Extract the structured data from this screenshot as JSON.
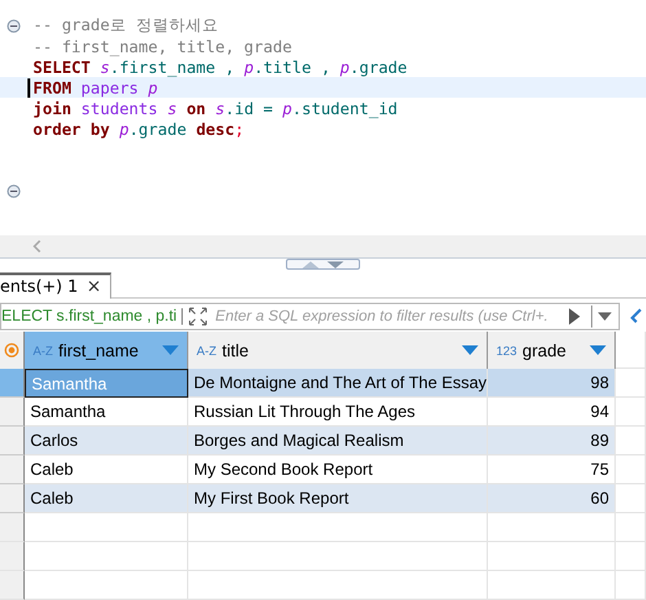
{
  "editor": {
    "lines": [
      {
        "fold": true,
        "current": false,
        "tokens": [
          {
            "kind": "comment",
            "text": "-- grade로 정렬하세요"
          }
        ]
      },
      {
        "fold": false,
        "current": false,
        "tokens": [
          {
            "kind": "comment",
            "text": "-- first_name, title, grade"
          }
        ]
      },
      {
        "fold": false,
        "current": false,
        "tokens": [
          {
            "kind": "keyword",
            "text": "SELECT "
          },
          {
            "kind": "alias",
            "text": "s"
          },
          {
            "kind": "plain",
            "text": ".first_name , "
          },
          {
            "kind": "alias",
            "text": "p"
          },
          {
            "kind": "plain",
            "text": ".title , "
          },
          {
            "kind": "alias",
            "text": "p"
          },
          {
            "kind": "plain",
            "text": ".grade"
          }
        ]
      },
      {
        "fold": false,
        "current": true,
        "tokens": [
          {
            "kind": "keyword",
            "text": "FROM "
          },
          {
            "kind": "table",
            "text": "papers "
          },
          {
            "kind": "alias",
            "text": "p"
          }
        ]
      },
      {
        "fold": false,
        "current": false,
        "tokens": [
          {
            "kind": "keyword",
            "text": "join "
          },
          {
            "kind": "table",
            "text": "students "
          },
          {
            "kind": "alias",
            "text": "s"
          },
          {
            "kind": "keyword",
            "text": " on "
          },
          {
            "kind": "alias",
            "text": "s"
          },
          {
            "kind": "plain",
            "text": ".id = "
          },
          {
            "kind": "alias",
            "text": "p"
          },
          {
            "kind": "plain",
            "text": ".student_id"
          }
        ]
      },
      {
        "fold": false,
        "current": false,
        "tokens": [
          {
            "kind": "keyword",
            "text": "order by "
          },
          {
            "kind": "alias",
            "text": "p"
          },
          {
            "kind": "plain",
            "text": ".grade "
          },
          {
            "kind": "keyword",
            "text": "desc"
          },
          {
            "kind": "punct",
            "text": ";"
          }
        ]
      },
      {
        "fold": true,
        "current": false
      }
    ]
  },
  "results": {
    "tabs": [
      {
        "label": "ents(+) 1",
        "selected": true,
        "close": "×"
      }
    ],
    "query": "ELECT s.first_name , p.ti",
    "filter": {
      "placeholder": "Enter a SQL expression to filter results (use Ctrl+."
    },
    "columns": [
      {
        "type": "A-Z",
        "label": "first_name",
        "selected": true
      },
      {
        "type": "A-Z",
        "label": "title",
        "selected": false
      },
      {
        "type": "123",
        "label": "grade",
        "selected": false
      }
    ],
    "rows": [
      {
        "selected": true,
        "cells": [
          "Samantha",
          "De Montaigne and The Art of The Essay",
          "98"
        ]
      },
      {
        "selected": false,
        "cells": [
          "Samantha",
          "Russian Lit Through The Ages",
          "94"
        ]
      },
      {
        "selected": false,
        "cells": [
          "Carlos",
          "Borges and Magical Realism",
          "89"
        ]
      },
      {
        "selected": false,
        "cells": [
          "Caleb",
          "My Second Book Report",
          "75"
        ]
      },
      {
        "selected": false,
        "cells": [
          "Caleb",
          "My First Book Report",
          "60"
        ]
      }
    ]
  }
}
